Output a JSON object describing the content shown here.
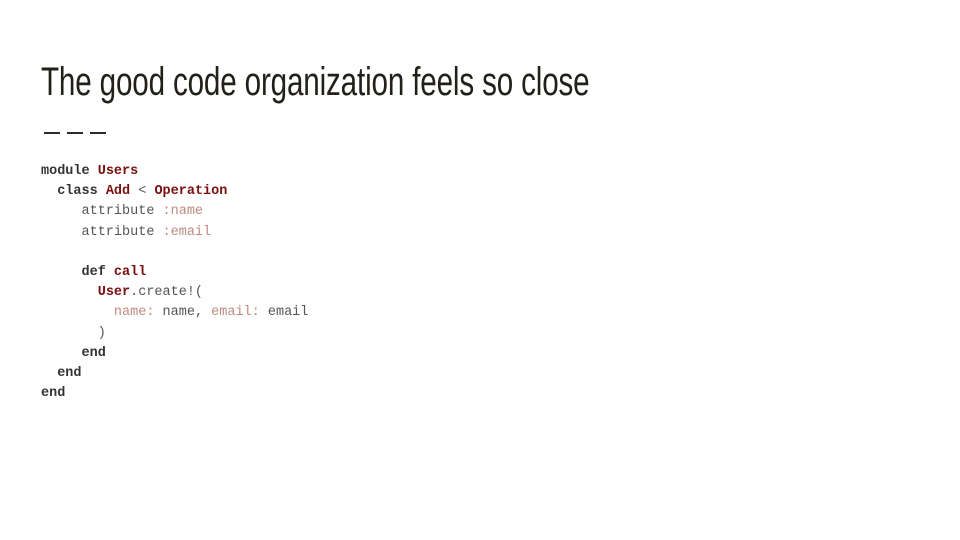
{
  "slide": {
    "title": "The good code organization feels so close"
  },
  "code": {
    "lines": [
      [
        {
          "t": "module ",
          "c": "kw"
        },
        {
          "t": "Users",
          "c": "const"
        }
      ],
      [
        {
          "t": "  class ",
          "c": "kw"
        },
        {
          "t": "Add",
          "c": "const"
        },
        {
          "t": " < ",
          "c": "op"
        },
        {
          "t": "Operation",
          "c": "const"
        }
      ],
      [
        {
          "t": "     attribute ",
          "c": "plain"
        },
        {
          "t": ":name",
          "c": "sym"
        }
      ],
      [
        {
          "t": "     attribute ",
          "c": "plain"
        },
        {
          "t": ":email",
          "c": "sym"
        }
      ],
      [
        {
          "t": "",
          "c": "plain"
        }
      ],
      [
        {
          "t": "     def ",
          "c": "kw"
        },
        {
          "t": "call",
          "c": "const"
        }
      ],
      [
        {
          "t": "       ",
          "c": "plain"
        },
        {
          "t": "User",
          "c": "const"
        },
        {
          "t": ".create!(",
          "c": "plain"
        }
      ],
      [
        {
          "t": "         ",
          "c": "plain"
        },
        {
          "t": "name:",
          "c": "sym"
        },
        {
          "t": " name, ",
          "c": "plain"
        },
        {
          "t": "email:",
          "c": "sym"
        },
        {
          "t": " email",
          "c": "plain"
        }
      ],
      [
        {
          "t": "       )",
          "c": "plain"
        }
      ],
      [
        {
          "t": "     end",
          "c": "kw"
        }
      ],
      [
        {
          "t": "  end",
          "c": "kw"
        }
      ],
      [
        {
          "t": "end",
          "c": "kw"
        }
      ]
    ]
  }
}
